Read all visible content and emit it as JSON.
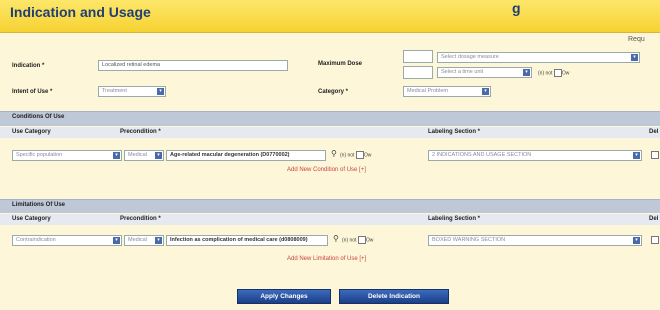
{
  "header": {
    "title": "Indication and Usage",
    "title_tail": "g"
  },
  "required_label": "Requ",
  "form": {
    "indication": {
      "label": "Indication",
      "value": "Localized retinal edema"
    },
    "intent_of_use": {
      "label": "Intent of Use",
      "value": "Treatment"
    },
    "maximum_dose": {
      "label": "Maximum Dose",
      "measure_placeholder": "Select dosage measure",
      "time_unit_placeholder": "Select a time unit",
      "na_label": "(n) not",
      "na_label2": "Ow"
    },
    "category": {
      "label": "Category",
      "value": "Medical Problem"
    }
  },
  "conditions": {
    "section_title": "Conditions Of Use",
    "col_use_category": "Use Category",
    "col_precondition": "Precondition",
    "col_labeling_section": "Labeling Section",
    "col_del": "Del",
    "row": {
      "use_category": "Specific population",
      "precondition_type": "Medical",
      "precondition_value": "Age-related macular degeneration (D0770002)",
      "na_label": "(n) not",
      "na_label2": "Ow",
      "labeling_section": "2 INDICATIONS AND USAGE SECTION"
    },
    "add_link": "Add New Condition of Use [+]"
  },
  "limitations": {
    "section_title": "Limitations Of Use",
    "col_use_category": "Use Category",
    "col_precondition": "Precondition",
    "col_labeling_section": "Labeling Section",
    "col_del": "Del",
    "row": {
      "use_category": "Contraindication",
      "precondition_type": "Medical",
      "precondition_value": "Infection as complication of medical care (d0808009)",
      "na_label": "(n) not",
      "na_label2": "Ow",
      "labeling_section": "BOXED WARNING SECTION"
    },
    "add_link": "Add New Limitation of Use [+]"
  },
  "buttons": {
    "apply": "Apply Changes",
    "delete": "Delete Indication"
  },
  "icons": {
    "search": "search-icon",
    "dropdown": "chevron-down-icon"
  },
  "colors": {
    "header": "#f6d232",
    "title": "#1f3f76",
    "section_bar": "#bfc8d6",
    "link": "#c64545",
    "button": "#1b3f86",
    "background": "#fdf6d8"
  }
}
